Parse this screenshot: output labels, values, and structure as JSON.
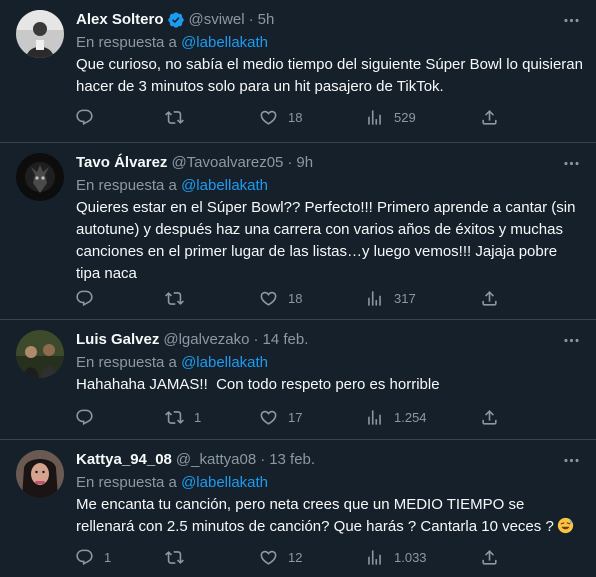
{
  "reply_prefix": "En respuesta a ",
  "dot": "·",
  "tweets": [
    {
      "name": "Alex Soltero",
      "handle": "@sviwel",
      "time": "5h",
      "reply_to": "@labellakath",
      "text": "Que curioso, no sabía el medio tiempo del siguiente Súper Bowl lo quisieran hacer de 3 minutos solo para un hit pasajero de TikTok.",
      "verified": true,
      "counts": {
        "replies": "",
        "retweets": "",
        "likes": "18",
        "views": "529"
      }
    },
    {
      "name": "Tavo Álvarez",
      "handle": "@Tavoalvarez05",
      "time": "9h",
      "reply_to": "@labellakath",
      "text": "Quieres estar en el Súper Bowl?? Perfecto!!! Primero aprende a cantar (sin autotune) y después haz una carrera con varios años de éxitos y muchas canciones en el primer lugar de las listas…y luego vemos!!! Jajaja pobre tipa naca",
      "verified": false,
      "counts": {
        "replies": "",
        "retweets": "",
        "likes": "18",
        "views": "317"
      }
    },
    {
      "name": "Luis Galvez",
      "handle": "@lgalvezako",
      "time": "14 feb.",
      "reply_to": "@labellakath",
      "text": "Hahahaha JAMAS!!  Con todo respeto pero es horrible",
      "verified": false,
      "counts": {
        "replies": "",
        "retweets": "1",
        "likes": "17",
        "views": "1.254"
      }
    },
    {
      "name": "Kattya_94_08",
      "handle": "@_kattya08",
      "time": "13 feb.",
      "reply_to": "@labellakath",
      "text": "Me encanta tu canción, pero neta crees que un MEDIO TIEMPO se rellenará con 2.5 minutos de canción? Que harás ? Cantarla 10 veces ?",
      "verified": false,
      "counts": {
        "replies": "1",
        "retweets": "",
        "likes": "12",
        "views": "1.033"
      }
    }
  ],
  "icons": {
    "verified": "verified-badge-icon",
    "more": "more-icon",
    "reply": "reply-icon",
    "retweet": "retweet-icon",
    "like": "heart-icon",
    "views": "views-icon",
    "share": "share-icon",
    "emoji": "sweat-smile-emoji-icon"
  },
  "colors": {
    "background": "#15202b",
    "text": "#f7f9f9",
    "secondary": "#8b98a5",
    "accent": "#1d9bf0",
    "divider": "#38444d"
  }
}
